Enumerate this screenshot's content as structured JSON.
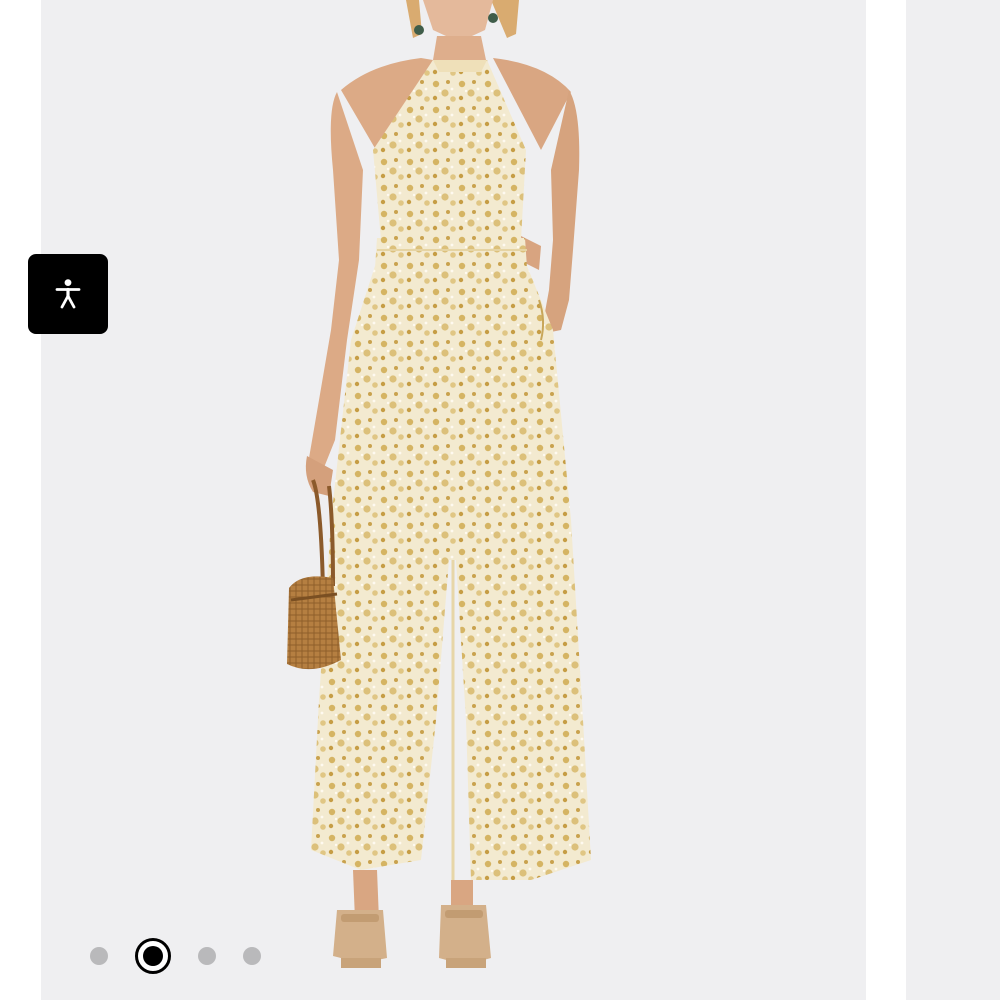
{
  "colors": {
    "slide_background": "#efeff1",
    "dress_base": "#f1e7c6",
    "dress_print": "#d2b15c",
    "skin": "#e0b08f",
    "accessibility_button": "#000000",
    "dot_inactive": "#b9b9bb",
    "dot_active": "#000000"
  },
  "accessibility": {
    "icon": "accessibility-person-icon"
  },
  "carousel": {
    "slide_count": 4,
    "active_index": 1,
    "dots": [
      {
        "active": false
      },
      {
        "active": true
      },
      {
        "active": false
      },
      {
        "active": false
      }
    ]
  }
}
